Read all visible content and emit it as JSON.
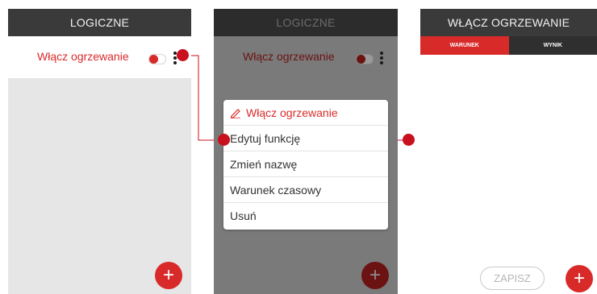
{
  "screen1": {
    "title": "LOGICZNE",
    "function_row": {
      "label": "Włącz ogrzewanie",
      "toggle_state": "on"
    },
    "fab_icon": "plus-icon",
    "fab_symbol": "+"
  },
  "screen2": {
    "title": "LOGICZNE",
    "function_row": {
      "label": "Włącz ogrzewanie",
      "toggle_state": "on"
    },
    "menu": {
      "header": "Włącz ogrzewanie",
      "header_icon": "pencil-icon",
      "items": [
        "Edytuj funkcję",
        "Zmień nazwę",
        "Warunek czasowy",
        "Usuń"
      ]
    },
    "fab_symbol": "+"
  },
  "screen3": {
    "title": "WŁĄCZ OGRZEWANIE",
    "tabs": [
      {
        "label": "WARUNEK",
        "active": true
      },
      {
        "label": "WYNIK",
        "active": false
      }
    ],
    "save_label": "ZAPISZ",
    "fab_symbol": "+"
  },
  "colors": {
    "accent_red": "#d92a2a",
    "annotation_red": "#c8101e",
    "title_bar": "#3a3a3a",
    "dim_overlay_bg": "#7a7a7a"
  }
}
